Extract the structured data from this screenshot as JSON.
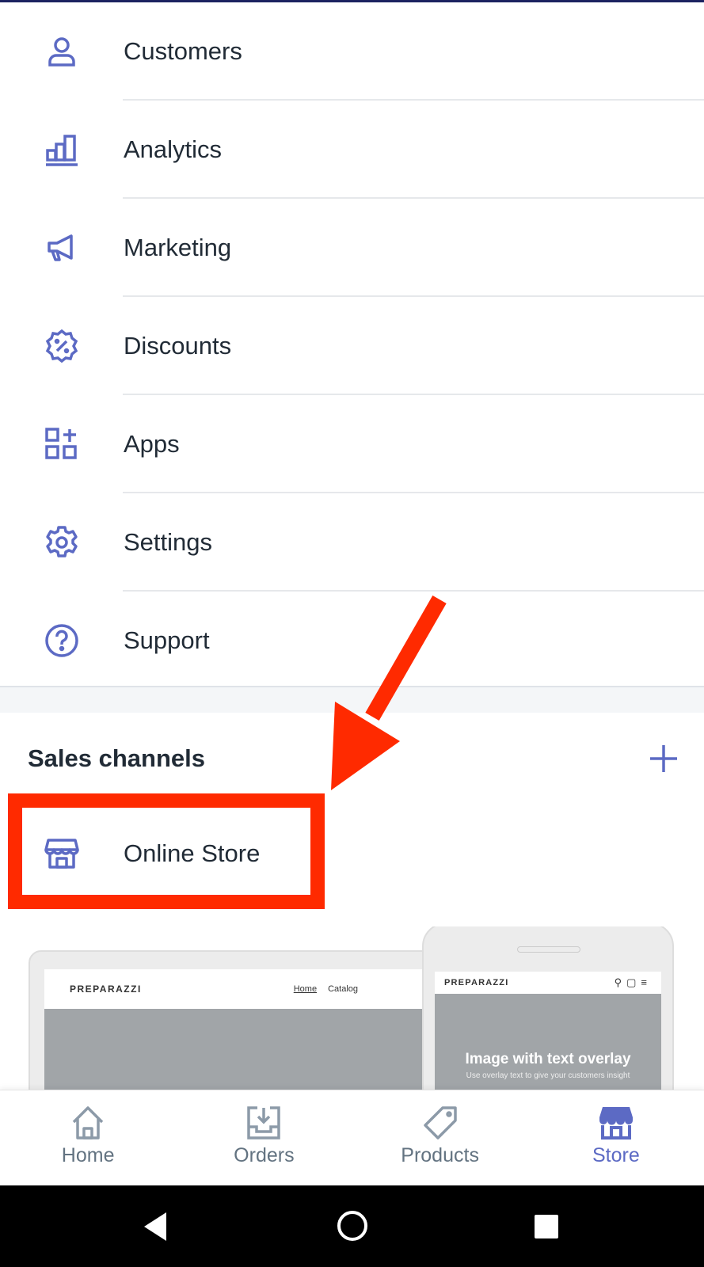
{
  "colors": {
    "accent": "#5c6ac4",
    "annotation": "#ff2a00",
    "text": "#212b36",
    "muted": "#637381"
  },
  "menu": {
    "items": [
      {
        "label": "Customers",
        "icon": "customer-icon"
      },
      {
        "label": "Analytics",
        "icon": "analytics-icon"
      },
      {
        "label": "Marketing",
        "icon": "megaphone-icon"
      },
      {
        "label": "Discounts",
        "icon": "discount-icon"
      },
      {
        "label": "Apps",
        "icon": "apps-icon"
      },
      {
        "label": "Settings",
        "icon": "gear-icon"
      },
      {
        "label": "Support",
        "icon": "help-icon"
      }
    ]
  },
  "sales_channels": {
    "title": "Sales channels",
    "add_icon": "plus-icon",
    "items": [
      {
        "label": "Online Store",
        "icon": "store-icon"
      }
    ]
  },
  "preview": {
    "brand": "PREPARAZZI",
    "links": [
      "Home",
      "Catalog"
    ],
    "overlay_title": "Image with text overlay",
    "overlay_sub": "Use overlay text to give your customers insight"
  },
  "tabbar": {
    "items": [
      {
        "label": "Home",
        "icon": "home-icon"
      },
      {
        "label": "Orders",
        "icon": "orders-icon"
      },
      {
        "label": "Products",
        "icon": "tag-icon"
      },
      {
        "label": "Store",
        "icon": "store-icon",
        "active": true
      }
    ]
  }
}
